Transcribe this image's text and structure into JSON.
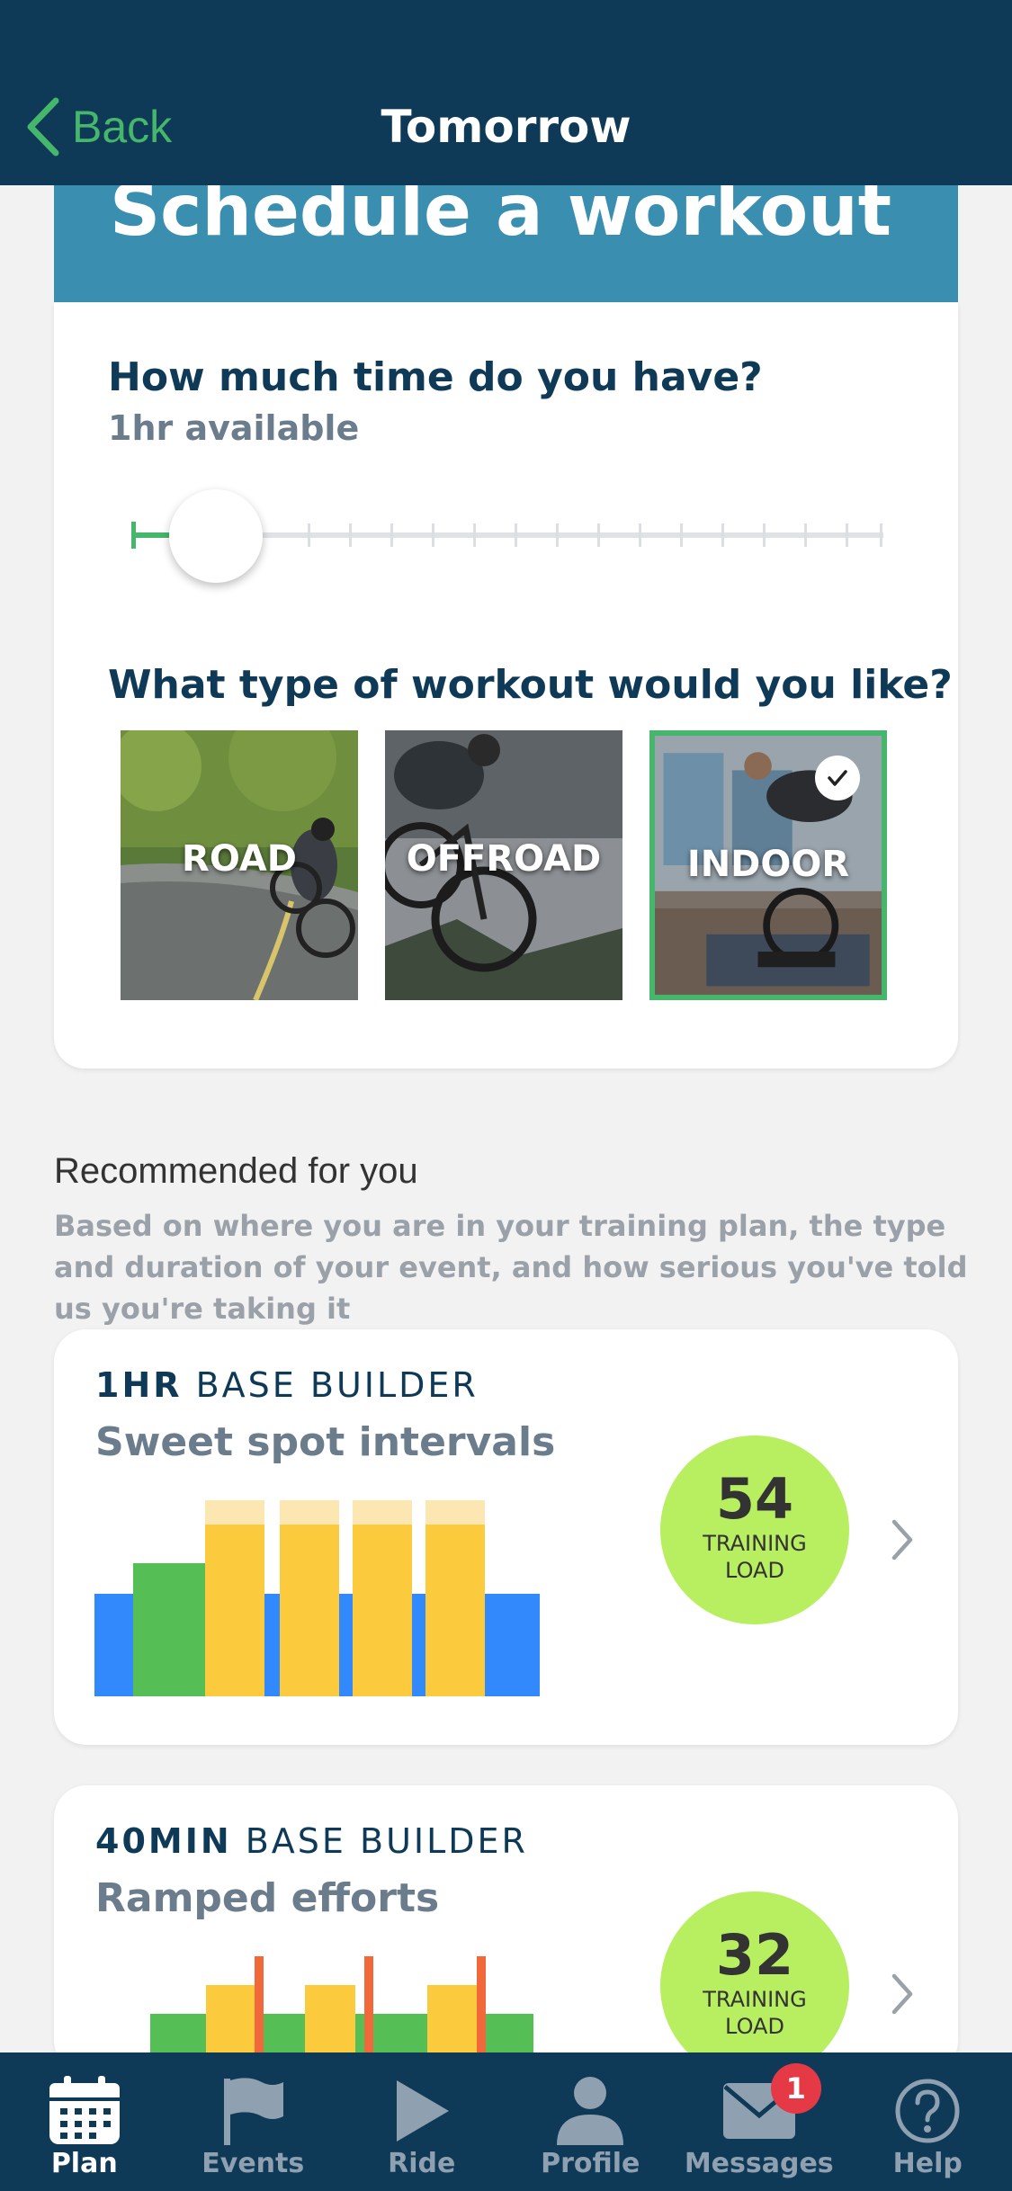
{
  "nav": {
    "back_label": "Back",
    "title": "Tomorrow"
  },
  "schedule": {
    "title": "Schedule a workout",
    "time_question": "How much time do you have?",
    "time_value": "1hr available",
    "type_question": "What type of workout would you like?",
    "types": [
      {
        "label": "ROAD",
        "selected": false
      },
      {
        "label": "OFFROAD",
        "selected": false
      },
      {
        "label": "INDOOR",
        "selected": true
      }
    ]
  },
  "recommended": {
    "title": "Recommended for you",
    "subtitle": "Based on where you are in your training plan, the type and duration of your event, and how serious you've told us you're taking it",
    "workouts": [
      {
        "duration": "1HR",
        "category": "BASE BUILDER",
        "name": "Sweet spot intervals",
        "load": "54",
        "load_label_1": "TRAINING",
        "load_label_2": "LOAD"
      },
      {
        "duration": "40MIN",
        "category": "BASE BUILDER",
        "name": "Ramped efforts",
        "load": "32",
        "load_label_1": "TRAINING",
        "load_label_2": "LOAD"
      }
    ]
  },
  "tabs": [
    {
      "label": "Plan",
      "icon": "calendar-icon",
      "active": true
    },
    {
      "label": "Events",
      "icon": "flag-icon",
      "active": false
    },
    {
      "label": "Ride",
      "icon": "play-icon",
      "active": false
    },
    {
      "label": "Profile",
      "icon": "person-icon",
      "active": false
    },
    {
      "label": "Messages",
      "icon": "mail-icon",
      "active": false,
      "badge": "1"
    },
    {
      "label": "Help",
      "icon": "help-icon",
      "active": false
    }
  ],
  "colors": {
    "navy": "#0f3a57",
    "teal": "#3a8fb0",
    "green": "#45b66b",
    "lime": "#b8ef60",
    "yellow": "#fbcb3d",
    "blue": "#3189fb"
  }
}
